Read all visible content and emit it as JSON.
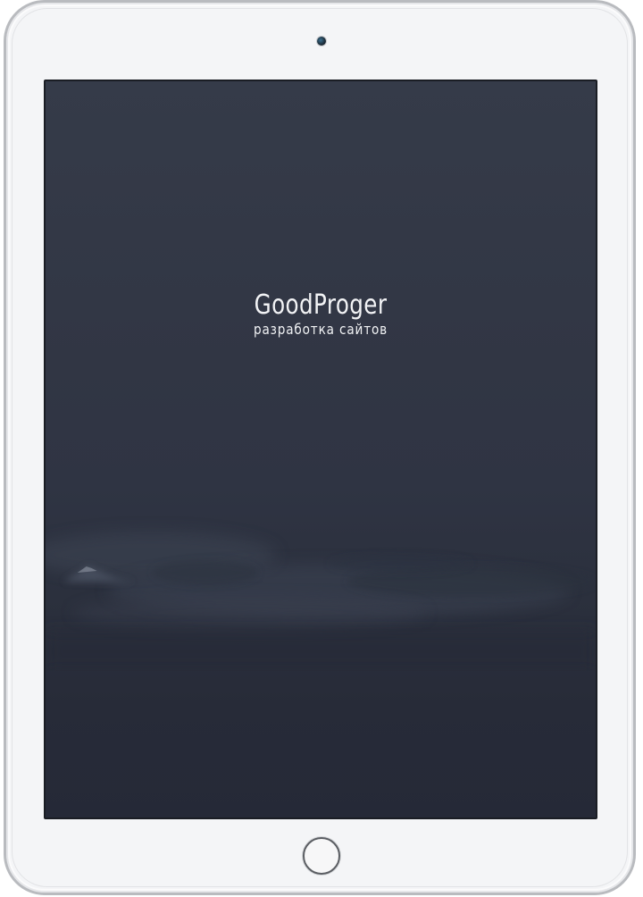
{
  "device": {
    "type": "tablet",
    "frame_color": "#f4f5f7",
    "screen_color": "#2f3443"
  },
  "screen": {
    "logo_title": "GoodProger",
    "logo_subtitle": "разработка сайтов",
    "background": "dark-foggy-mountains"
  },
  "icons": {
    "camera": "camera-icon",
    "home": "home-button"
  }
}
